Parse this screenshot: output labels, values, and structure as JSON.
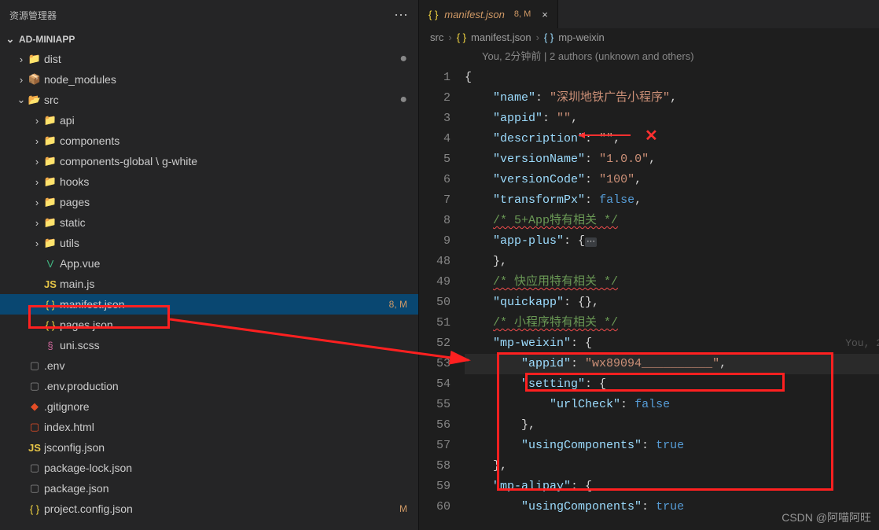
{
  "sidebar": {
    "title": "资源管理器",
    "project": "AD-MINIAPP",
    "items": [
      {
        "indent": 20,
        "chev": "›",
        "icon": "📁",
        "ic": "ic-folder",
        "label": "dist",
        "status": "●",
        "statCls": "dot"
      },
      {
        "indent": 20,
        "chev": "›",
        "icon": "📦",
        "ic": "ic-folder",
        "label": "node_modules"
      },
      {
        "indent": 20,
        "chev": "⌄",
        "icon": "📂",
        "ic": "ic-src",
        "label": "src",
        "status": "●",
        "statCls": "dot"
      },
      {
        "indent": 40,
        "chev": "›",
        "icon": "📁",
        "ic": "ic-folder",
        "label": "api"
      },
      {
        "indent": 40,
        "chev": "›",
        "icon": "📁",
        "ic": "ic-folder",
        "label": "components"
      },
      {
        "indent": 40,
        "chev": "›",
        "icon": "📁",
        "ic": "ic-folder",
        "label": "components-global \\ g-white"
      },
      {
        "indent": 40,
        "chev": "›",
        "icon": "📁",
        "ic": "ic-folder",
        "label": "hooks"
      },
      {
        "indent": 40,
        "chev": "›",
        "icon": "📁",
        "ic": "ic-folder",
        "label": "pages"
      },
      {
        "indent": 40,
        "chev": "›",
        "icon": "📁",
        "ic": "ic-folder",
        "label": "static"
      },
      {
        "indent": 40,
        "chev": "›",
        "icon": "📁",
        "ic": "ic-folder",
        "label": "utils"
      },
      {
        "indent": 40,
        "chev": "",
        "icon": "V",
        "ic": "ic-vue",
        "label": "App.vue"
      },
      {
        "indent": 40,
        "chev": "",
        "icon": "JS",
        "ic": "ic-js",
        "label": "main.js"
      },
      {
        "indent": 40,
        "chev": "",
        "icon": "{ }",
        "ic": "ic-json",
        "label": "manifest.json",
        "status": "8, M",
        "statCls": "",
        "active": true
      },
      {
        "indent": 40,
        "chev": "",
        "icon": "{ }",
        "ic": "ic-json",
        "label": "pages.json"
      },
      {
        "indent": 40,
        "chev": "",
        "icon": "§",
        "ic": "ic-scss",
        "label": "uni.scss"
      },
      {
        "indent": 20,
        "chev": "",
        "icon": "▢",
        "ic": "ic-file",
        "label": ".env"
      },
      {
        "indent": 20,
        "chev": "",
        "icon": "▢",
        "ic": "ic-file",
        "label": ".env.production"
      },
      {
        "indent": 20,
        "chev": "",
        "icon": "◆",
        "ic": "ic-html",
        "label": ".gitignore"
      },
      {
        "indent": 20,
        "chev": "",
        "icon": "▢",
        "ic": "ic-html",
        "label": "index.html"
      },
      {
        "indent": 20,
        "chev": "",
        "icon": "JS",
        "ic": "ic-js",
        "label": "jsconfig.json"
      },
      {
        "indent": 20,
        "chev": "",
        "icon": "▢",
        "ic": "ic-file",
        "label": "package-lock.json"
      },
      {
        "indent": 20,
        "chev": "",
        "icon": "▢",
        "ic": "ic-file",
        "label": "package.json"
      },
      {
        "indent": 20,
        "chev": "",
        "icon": "{ }",
        "ic": "ic-json",
        "label": "project.config.json",
        "status": "M",
        "statCls": ""
      }
    ]
  },
  "tab": {
    "icon": "{ }",
    "name": "manifest.json",
    "git": "8, M",
    "close": "×"
  },
  "breadcrumbs": {
    "seg1": "src",
    "seg2": "manifest.json",
    "seg3": "mp-weixin"
  },
  "authors": "You, 2分钟前 | 2 authors (unknown and others)",
  "blame": "You, 2",
  "code": {
    "linenos": [
      "1",
      "2",
      "3",
      "4",
      "5",
      "6",
      "7",
      "8",
      "9",
      "48",
      "49",
      "50",
      "51",
      "52",
      "53",
      "54",
      "55",
      "56",
      "57",
      "58",
      "59",
      "60"
    ],
    "name_key": "\"name\"",
    "name_val": "\"深圳地铁广告小程序\"",
    "appid_key": "\"appid\"",
    "appid_val": "\"\"",
    "desc_key": "\"description\"",
    "desc_val": "\"\"",
    "vname_key": "\"versionName\"",
    "vname_val": "\"1.0.0\"",
    "vcode_key": "\"versionCode\"",
    "vcode_val": "\"100\"",
    "tpx_key": "\"transformPx\"",
    "tpx_val": "false",
    "c1": "/* 5+App特有相关 */",
    "appplus_key": "\"app-plus\"",
    "c2": "/* 快应用特有相关 */",
    "quickapp_key": "\"quickapp\"",
    "c3": "/* 小程序特有相关 */",
    "mpwx_key": "\"mp-weixin\"",
    "wx_appid_key": "\"appid\"",
    "wx_appid_val": "\"wx89094__________\"",
    "setting_key": "\"setting\"",
    "urlcheck_key": "\"urlCheck\"",
    "urlcheck_val": "false",
    "using_key": "\"usingComponents\"",
    "using_val": "true",
    "alipay_key": "\"mp-alipay\"",
    "using2_key": "\"usingComponents\"",
    "using2_val": "true"
  },
  "watermark": "CSDN @阿喵阿旺"
}
